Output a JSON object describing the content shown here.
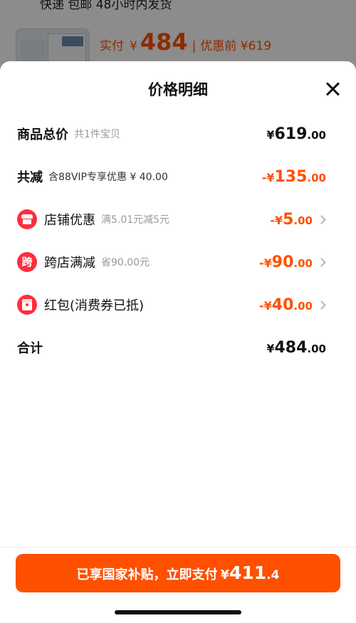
{
  "background": {
    "shipping_text": "快递 包邮 48小时内发货",
    "price_label": "实付",
    "currency": "¥",
    "price_value": "484",
    "separator": "|",
    "pre_discount": "优惠前 ¥619"
  },
  "sheet": {
    "title": "价格明细",
    "close_icon": "close-icon",
    "rows": {
      "total": {
        "label": "商品总价",
        "sub": "共1件宝贝",
        "currency": "¥",
        "int": "619",
        "dec": ".00"
      },
      "discount_total": {
        "label": "共减",
        "sub": "含88VIP专享优惠 ¥ 40.00",
        "currency": "-¥",
        "int": "135",
        "dec": ".00"
      },
      "store": {
        "icon": "store-icon",
        "label": "店铺优惠",
        "sub": "满5.01元减5元",
        "currency": "-¥",
        "int": "5",
        "dec": ".00"
      },
      "cross_store": {
        "icon": "cross-store-icon",
        "icon_char": "跨",
        "label": "跨店满减",
        "sub": "省90.00元",
        "currency": "-¥",
        "int": "90",
        "dec": ".00"
      },
      "red_packet": {
        "icon": "red-packet-icon",
        "label": "红包(消费券已抵)",
        "currency": "-¥",
        "int": "40",
        "dec": ".00"
      },
      "sum": {
        "label": "合计",
        "currency": "¥",
        "int": "484",
        "dec": ".00"
      }
    },
    "pay_button": {
      "text": "已享国家补贴，立即支付",
      "currency": "¥",
      "int": "411",
      "dec": ".4"
    }
  },
  "colors": {
    "accent": "#ff5000",
    "icon_red": "#ff2d3d"
  }
}
